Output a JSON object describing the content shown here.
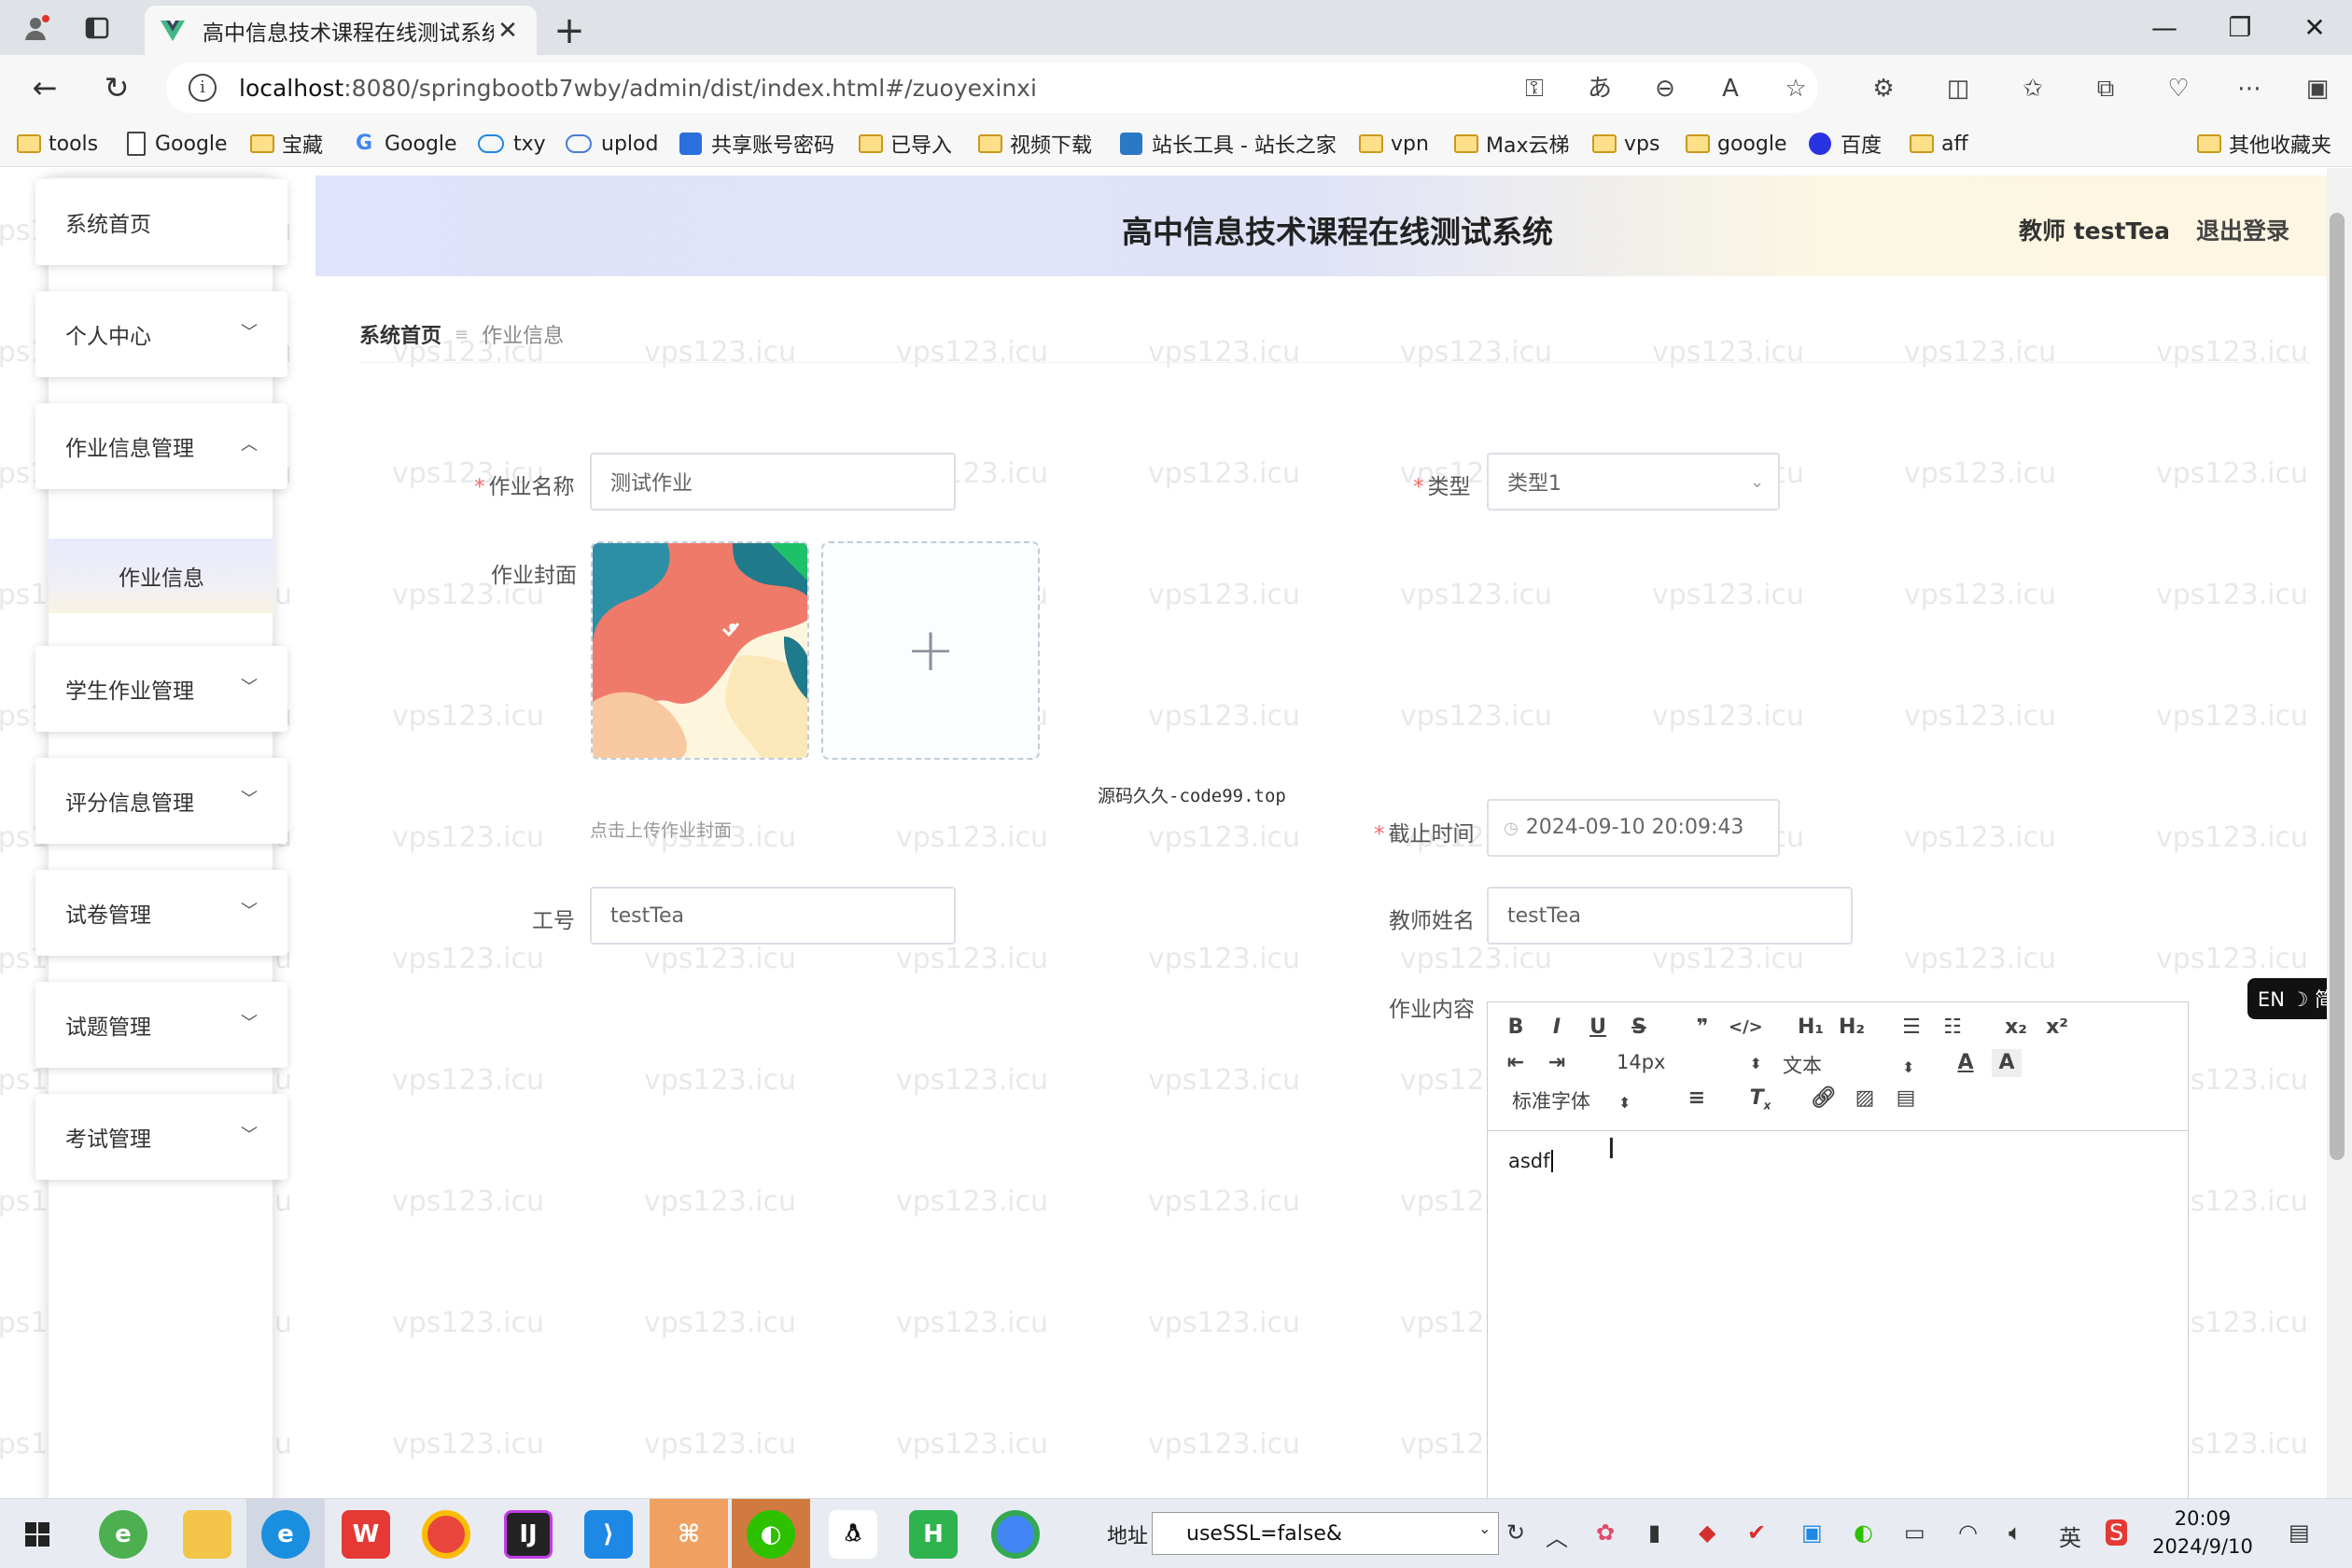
{
  "browser": {
    "tab_title": "高中信息技术课程在线测试系统",
    "url_host": "localhost",
    "url_path": ":8080/springbootb7wby/admin/dist/index.html#/zuoyexinxi",
    "bookmarks": [
      "tools",
      "Google",
      "宝藏",
      "Google",
      "txy",
      "uplod",
      "共享账号密码",
      "已导入",
      "视频下载",
      "站长工具 - 站长之家",
      "vpn",
      "Max云梯",
      "vps",
      "google",
      "百度",
      "aff",
      "其他收藏夹"
    ]
  },
  "header": {
    "title": "高中信息技术课程在线测试系统",
    "user_info": "教师 testTea",
    "logout": "退出登录"
  },
  "sidebar": {
    "items": [
      {
        "label": "系统首页"
      },
      {
        "label": "个人中心"
      },
      {
        "label": "作业信息管理"
      },
      {
        "label": "作业信息"
      },
      {
        "label": "学生作业管理"
      },
      {
        "label": "评分信息管理"
      },
      {
        "label": "试卷管理"
      },
      {
        "label": "试题管理"
      },
      {
        "label": "考试管理"
      }
    ]
  },
  "breadcrumb": {
    "home": "系统首页",
    "current": "作业信息"
  },
  "form": {
    "name_label": "作业名称",
    "name_value": "测试作业",
    "type_label": "类型",
    "type_value": "类型1",
    "cover_label": "作业封面",
    "cover_hint": "点击上传作业封面",
    "deadline_label": "截止时间",
    "deadline_value": "2024-09-10 20:09:43",
    "work_no_label": "工号",
    "work_no_value": "testTea",
    "teacher_label": "教师姓名",
    "teacher_value": "testTea",
    "content_label": "作业内容",
    "content_value": "asdf"
  },
  "editor": {
    "font_size": "14px",
    "text_type": "文本",
    "font_family": "标准字体"
  },
  "overlay_text": "源码久久-code99.top",
  "watermark": "vps123.icu",
  "ime": "EN ☽ 简",
  "taskbar": {
    "addr_label": "地址",
    "addr_value": "useSSL=false&",
    "ime_lang": "英",
    "time": "20:09",
    "date": "2024/9/10"
  }
}
